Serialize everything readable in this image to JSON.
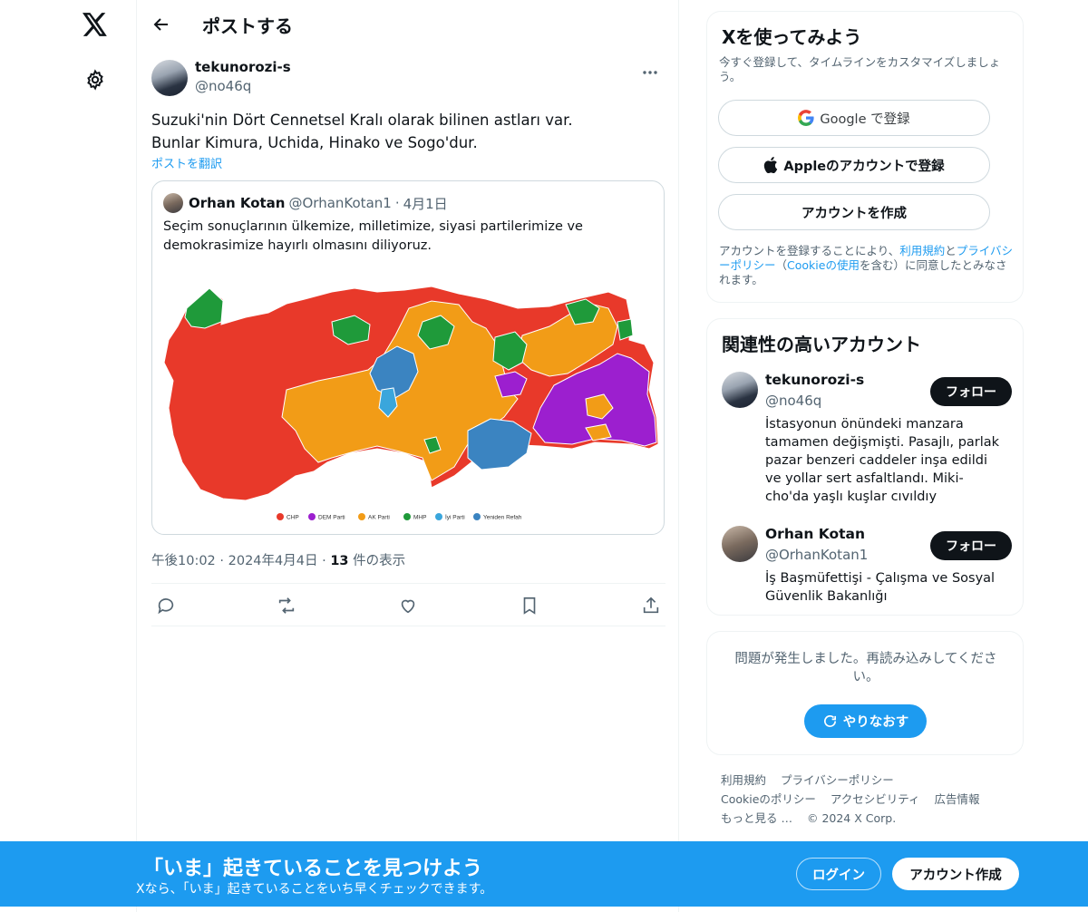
{
  "header": {
    "title": "ポストする"
  },
  "post": {
    "author_name": "tekunorozi-s",
    "author_handle": "@no46q",
    "text_line1": "Suzuki'nin Dört Cennetsel Kralı olarak bilinen astları var.",
    "text_line2": "Bunlar Kimura, Uchida, Hinako ve Sogo'dur.",
    "translate_label": "ポストを翻訳",
    "time": "午後10:02",
    "date": "2024年4月4日",
    "views_count": "13",
    "views_label": "件の表示"
  },
  "quote": {
    "author_name": "Orhan Kotan",
    "author_handle": "@OrhanKotan1",
    "separator": "·",
    "date": "4月1日",
    "text": "Seçim sonuçlarının ülkemize, milletimize, siyasi partilerimize ve demokrasimize hayırlı olmasını diliyoruz.",
    "map_legend": [
      {
        "label": "CHP",
        "color": "#e8392a"
      },
      {
        "label": "DEM Parti",
        "color": "#9c1fcf"
      },
      {
        "label": "AK Parti",
        "color": "#f29c17"
      },
      {
        "label": "MHP",
        "color": "#1f9a3a"
      },
      {
        "label": "İyi Parti",
        "color": "#3aa6dc"
      },
      {
        "label": "Yeniden Refah",
        "color": "#3b84c1"
      }
    ]
  },
  "signup": {
    "title": "Xを使ってみよう",
    "subtitle": "今すぐ登録して、タイムラインをカスタマイズしましょう。",
    "google_label": "Google で登録",
    "apple_label": "Appleのアカウントで登録",
    "create_label": "アカウントを作成",
    "legal_prefix": "アカウントを登録することにより、",
    "legal_terms": "利用規約",
    "legal_and": "と",
    "legal_privacy": "プライバシーポリシー",
    "legal_mid": "（",
    "legal_cookie": "Cookieの使用",
    "legal_suffix": "を含む）に同意したとみなされます。"
  },
  "related": {
    "title": "関連性の高いアカウント",
    "accounts": [
      {
        "name": "tekunorozi-s",
        "handle": "@no46q",
        "bio": "İstasyonun önündeki manzara tamamen değişmişti. Pasajlı, parlak pazar benzeri caddeler inşa edildi ve yollar sert asfaltlandı. Miki-cho'da yaşlı kuşlar cıvıldıy",
        "follow_label": "フォロー"
      },
      {
        "name": "Orhan Kotan",
        "handle": "@OrhanKotan1",
        "bio": "İş Başmüfettişi - Çalışma ve Sosyal Güvenlik Bakanlığı",
        "follow_label": "フォロー"
      }
    ]
  },
  "error": {
    "message": "問題が発生しました。再読み込みしてください。",
    "retry_label": "やりなおす"
  },
  "footer": {
    "links": [
      "利用規約",
      "プライバシーポリシー",
      "Cookieのポリシー",
      "アクセシビリティ",
      "広告情報",
      "もっと見る …",
      "© 2024 X Corp."
    ]
  },
  "banner": {
    "title": "「いま」起きていることを見つけよう",
    "subtitle": "Xなら、「いま」起きていることをいち早くチェックできます。",
    "login_label": "ログイン",
    "create_label": "アカウント作成"
  },
  "colors": {
    "accent": "#1d9bf0",
    "text": "#0f1419",
    "muted": "#536471"
  }
}
